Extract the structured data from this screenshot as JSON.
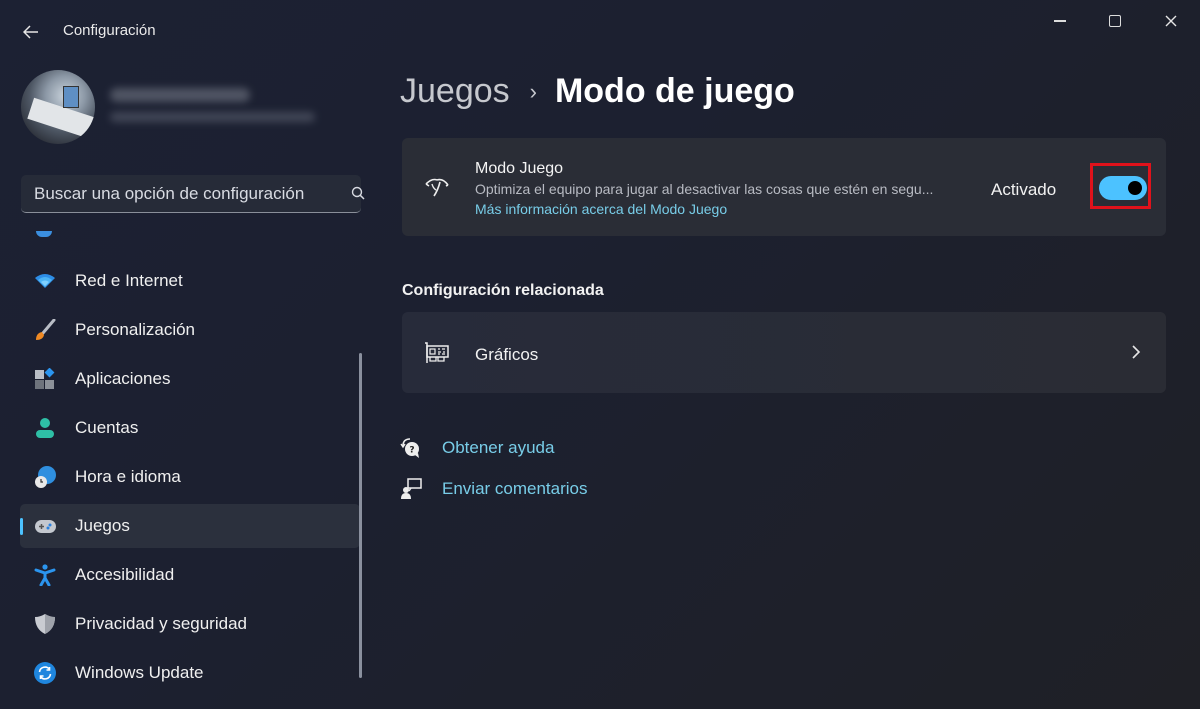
{
  "window": {
    "title": "Configuración",
    "controls": [
      "minimize",
      "maximize",
      "close"
    ]
  },
  "profile": {
    "name_blurred": true,
    "email_blurred": true
  },
  "search": {
    "placeholder": "Buscar una opción de configuración"
  },
  "sidebar": {
    "items": [
      {
        "label": "Red e Internet",
        "icon": "wifi-icon"
      },
      {
        "label": "Personalización",
        "icon": "brush-icon"
      },
      {
        "label": "Aplicaciones",
        "icon": "apps-icon"
      },
      {
        "label": "Cuentas",
        "icon": "account-icon"
      },
      {
        "label": "Hora e idioma",
        "icon": "time-language-icon"
      },
      {
        "label": "Juegos",
        "icon": "gamepad-icon",
        "active": true
      },
      {
        "label": "Accesibilidad",
        "icon": "accessibility-icon"
      },
      {
        "label": "Privacidad y seguridad",
        "icon": "shield-icon"
      },
      {
        "label": "Windows Update",
        "icon": "update-icon"
      }
    ]
  },
  "breadcrumb": {
    "parent": "Juegos",
    "separator": "›",
    "current": "Modo de juego"
  },
  "game_mode": {
    "title": "Modo Juego",
    "description": "Optimiza el equipo para jugar al desactivar las cosas que estén en segu...",
    "link": "Más información acerca del Modo Juego",
    "state_label": "Activado",
    "enabled": true
  },
  "related": {
    "title": "Configuración relacionada",
    "items": [
      {
        "label": "Gráficos",
        "icon": "graphics-card-icon"
      }
    ]
  },
  "help_links": [
    {
      "label": "Obtener ayuda",
      "icon": "help-icon"
    },
    {
      "label": "Enviar comentarios",
      "icon": "feedback-icon"
    }
  ],
  "colors": {
    "accent": "#4cc2ff",
    "link": "#78cde8",
    "highlight": "#e0121b"
  }
}
